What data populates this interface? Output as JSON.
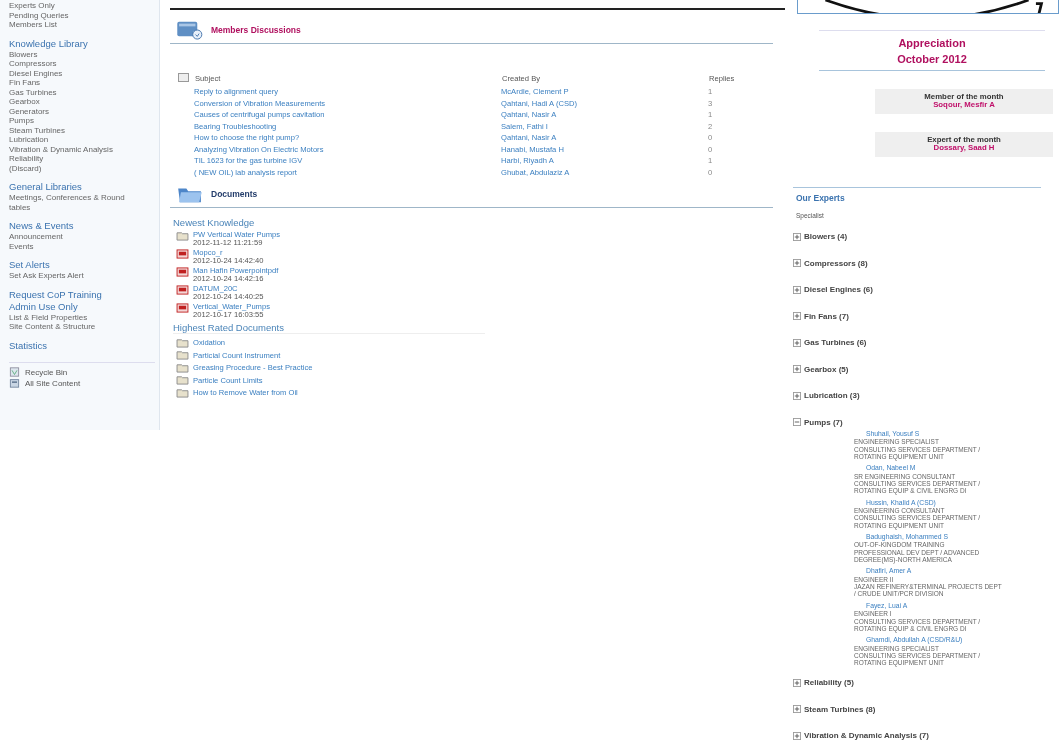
{
  "sidebar": {
    "top_items": [
      "Experts Only",
      "Pending Queries",
      "Members List"
    ],
    "sections": [
      {
        "heading": "Knowledge Library",
        "items": [
          "Blowers",
          "Compressors",
          "Diesel Engines",
          "Fin Fans",
          "Gas Turbines",
          "Gearbox",
          "Generators",
          "Pumps",
          "Steam Turbines",
          "Lubrication",
          "Vibration & Dynamic Analysis",
          "Reliability",
          "(Discard)"
        ]
      },
      {
        "heading": "General Libraries",
        "items": [
          "Meetings, Conferences & Round tables"
        ]
      },
      {
        "heading": "News & Events",
        "items": [
          "Announcement",
          "Events"
        ]
      },
      {
        "heading": "Set Alerts",
        "items": [
          "Set Ask Experts Alert"
        ]
      },
      {
        "heading": "Request CoP Training"
      },
      {
        "heading": "Admin Use Only",
        "items": [
          "List & Field Properties",
          "Site Content & Structure"
        ]
      },
      {
        "heading": "Statistics"
      }
    ],
    "footer_links": [
      {
        "kind": "recycle",
        "label": "Recycle Bin"
      },
      {
        "kind": "content",
        "label": "All Site Content"
      }
    ]
  },
  "discussions": {
    "title": "Members Discussions",
    "select_all_checked": false,
    "columns": [
      "Subject",
      "Created By",
      "Replies"
    ],
    "rows": [
      {
        "subject": "Reply to alignment query",
        "created_by": "McArdle, Clement P",
        "replies": "1"
      },
      {
        "subject": "Conversion of Vibration Measurements",
        "created_by": "Qahtani, Hadi A (CSD)",
        "replies": "3"
      },
      {
        "subject": "Causes of centrifugal pumps cavitation",
        "created_by": "Qahtani, Nasir A",
        "replies": "1"
      },
      {
        "subject": "Bearing Troubleshooting",
        "created_by": "Salem, Fathi I",
        "replies": "2"
      },
      {
        "subject": "How to choose the right pump?",
        "created_by": "Qahtani, Nasir A",
        "replies": "0"
      },
      {
        "subject": "Analyzing Vibration On Electric Motors",
        "created_by": "Hanabi, Mustafa H",
        "replies": "0"
      },
      {
        "subject": "TIL 1623 for the gas turbine IGV",
        "created_by": "Harbi, Riyadh A",
        "replies": "1"
      },
      {
        "subject": "( NEW OIL) lab analysis report",
        "created_by": "Ghubat, Abdulaziz A",
        "replies": "0"
      }
    ]
  },
  "documents": {
    "title": "Documents",
    "newest_heading": "Newest Knowledge",
    "newest": [
      {
        "kind": "folder",
        "name": "PW Vertical Water Pumps",
        "date": "2012-11-12 11:21:59"
      },
      {
        "kind": "pdf",
        "name": "Mopco_r",
        "date": "2012-10-24 14:42:40"
      },
      {
        "kind": "pdf",
        "name": "Man Hafin Powerpointpdf",
        "date": "2012-10-24 14:42:16"
      },
      {
        "kind": "pdf",
        "name": "DATUM_20C",
        "date": "2012-10-24 14:40:25"
      },
      {
        "kind": "pdf",
        "name": "Vertical_Water_Pumps",
        "date": "2012-10-17 16:03:55"
      }
    ],
    "rated_heading": "Highest Rated Documents",
    "rated": [
      "Oxidation",
      "Particial Count Instrument",
      "Greasing Procedure - Best Practice",
      "Particle Count Limits",
      "How to Remove Water from Oil"
    ]
  },
  "appreciation": {
    "title": "Appreciation",
    "month": "October 2012",
    "awards": [
      {
        "label": "Member of the month",
        "name": "Soqour, Mesfir A"
      },
      {
        "label": "Expert of the month",
        "name": "Dossary, Saad H"
      }
    ]
  },
  "experts": {
    "title": "Our Experts",
    "subtitle": "Specialist",
    "categories": [
      {
        "label": "Blowers (4)",
        "expanded": false
      },
      {
        "label": "Compressors (8)",
        "expanded": false
      },
      {
        "label": "Diesel Engines (6)",
        "expanded": false
      },
      {
        "label": "Fin Fans (7)",
        "expanded": false
      },
      {
        "label": "Gas Turbines (6)",
        "expanded": false
      },
      {
        "label": "Gearbox (5)",
        "expanded": false
      },
      {
        "label": "Lubrication (3)",
        "expanded": false
      },
      {
        "label": "Pumps (7)",
        "expanded": true,
        "children": [
          {
            "name": "Shuhail, Yousuf S",
            "title": "ENGINEERING SPECIALIST",
            "dept": "CONSULTING SERVICES DEPARTMENT / ROTATING EQUIPMENT UNIT"
          },
          {
            "name": "Odan, Nabeel M",
            "title": "SR ENGINEERING CONSULTANT",
            "dept": "CONSULTING SERVICES DEPARTMENT / ROTATING EQUIP & CIVIL ENGRG DI"
          },
          {
            "name": "Hussin, Khalid A (CSD)",
            "title": "ENGINEERING CONSULTANT",
            "dept": "CONSULTING SERVICES DEPARTMENT / ROTATING EQUIPMENT UNIT"
          },
          {
            "name": "Badughaish, Mohammed S",
            "title": "OUT-OF-KINGDOM TRAINING",
            "dept": "PROFESSIONAL DEV DEPT / ADVANCED DEGREE(MS)-NORTH AMERICA"
          },
          {
            "name": "Dhafiri, Amer A",
            "title": "ENGINEER II",
            "dept": "JAZAN REFINERY&TERMINAL PROJECTS DEPT / CRUDE UNIT/PCR DIVISION"
          },
          {
            "name": "Fayez, Luai A",
            "title": "ENGINEER I",
            "dept": "CONSULTING SERVICES DEPARTMENT / ROTATING EQUIP & CIVIL ENGRG DI"
          },
          {
            "name": "Ghamdi, Abdullah A (CSD/R&U)",
            "title": "ENGINEERING SPECIALIST",
            "dept": "CONSULTING SERVICES DEPARTMENT / ROTATING EQUIPMENT UNIT"
          }
        ]
      },
      {
        "label": "Reliability (5)",
        "expanded": false
      },
      {
        "label": "Steam Turbines (8)",
        "expanded": false
      },
      {
        "label": "Vibration & Dynamic Analysis (7)",
        "expanded": false
      }
    ]
  }
}
